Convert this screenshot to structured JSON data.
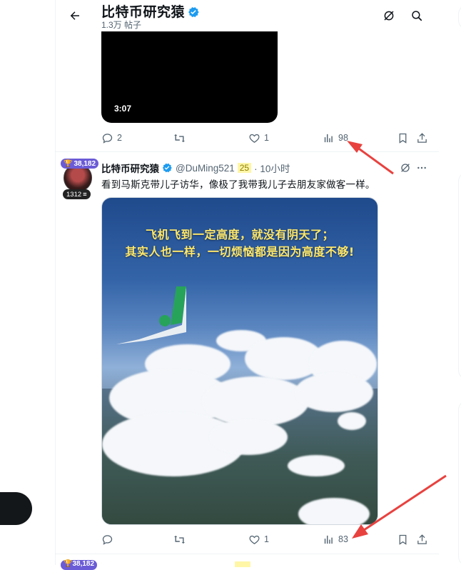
{
  "header": {
    "title": "比特币研究猿",
    "post_count": "1.3万 帖子"
  },
  "tweet1": {
    "video_duration": "3:07",
    "replies": "2",
    "likes": "1",
    "views": "98"
  },
  "tweet2": {
    "author_name": "比特币研究猿",
    "handle": "@DuMing521",
    "number_chip": "25",
    "time": "· 10小时",
    "badge_top": "38,182",
    "badge_bottom": "1312",
    "text": "看到马斯克带儿子访华，像极了我带我儿子去朋友家做客一样。",
    "image_caption_line1": "飞机飞到一定高度，就没有阴天了；",
    "image_caption_line2": "其实人也一样，一切烦恼都是因为高度不够!",
    "likes": "1",
    "views": "83"
  },
  "tweet3": {
    "badge_top": "38,182"
  },
  "colors": {
    "accent": "#1d9bf0",
    "muted": "#536471",
    "arrow": "#e8423f",
    "badge": "#6b5bd6"
  }
}
